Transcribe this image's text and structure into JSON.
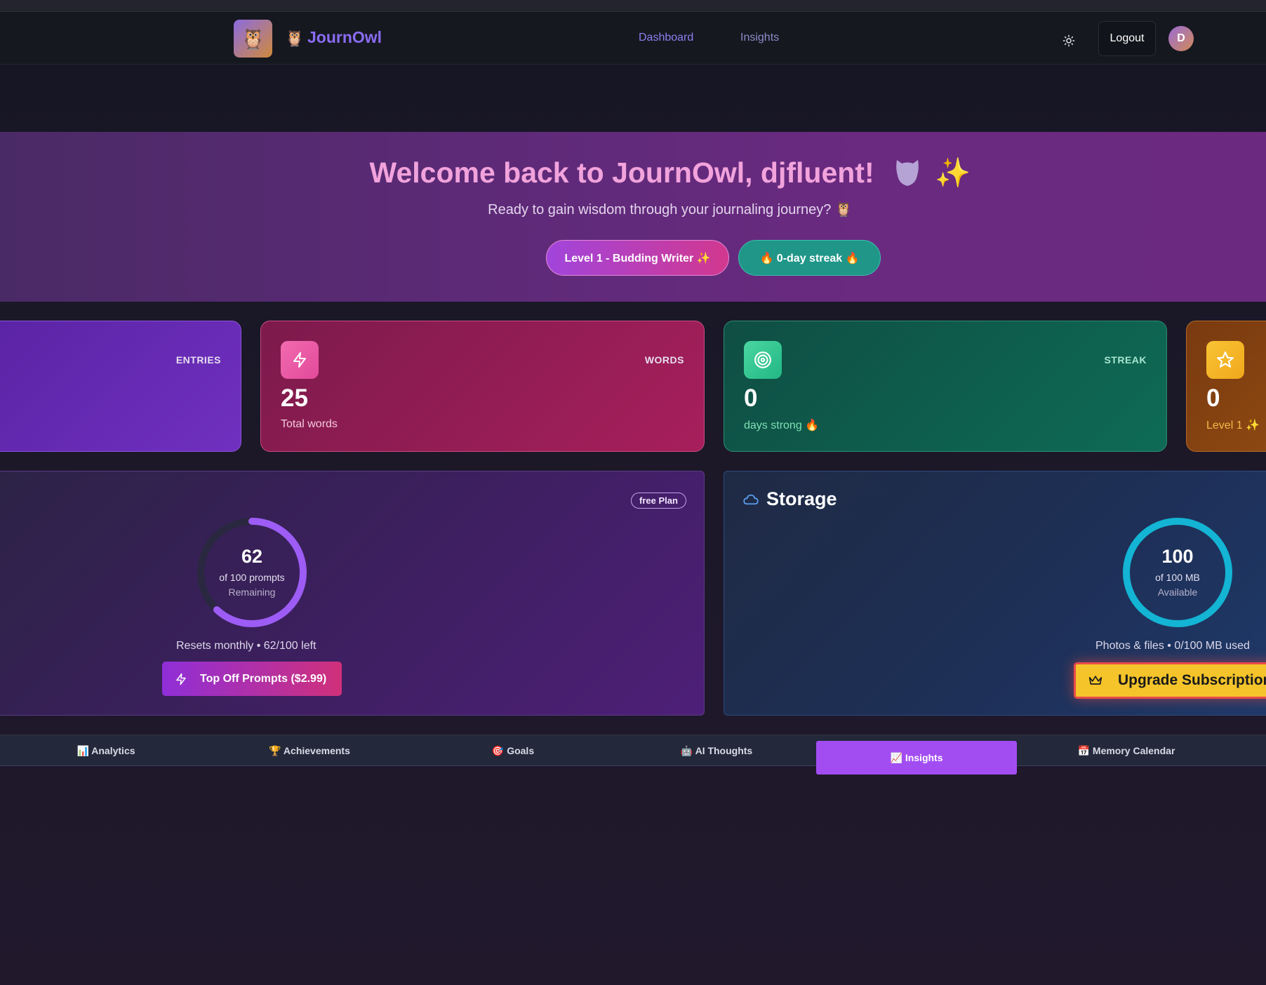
{
  "app": {
    "brand_emoji": "🦉",
    "brand_name": "JournOwl"
  },
  "nav": {
    "links": [
      "Dashboard",
      "Insights"
    ],
    "logout_label": "Logout",
    "avatar_initial": "D"
  },
  "hero": {
    "title": "Welcome back to JournOwl, djfluent!",
    "title_emoji": "✨",
    "subtitle": "Ready to gain wisdom through your journaling journey? 🦉",
    "level_pill": "Level 1 - Budding Writer ✨",
    "streak_pill": "🔥 0-day streak 🔥"
  },
  "stats": {
    "entries": {
      "label": "ENTRIES"
    },
    "words": {
      "label": "WORDS",
      "value": "25",
      "caption": "Total words"
    },
    "streak": {
      "label": "STREAK",
      "value": "0",
      "caption": "days strong 🔥"
    },
    "level": {
      "value": "0",
      "caption": "Level 1 ✨"
    }
  },
  "prompts": {
    "plan_badge": "free Plan",
    "remaining": "62",
    "total_label": "of 100 prompts",
    "status": "Remaining",
    "progress": 0.62,
    "reset_text": "Resets monthly • 62/100 left",
    "topoff_label": "Top Off Prompts ($2.99)"
  },
  "storage": {
    "title": "Storage",
    "available": "100",
    "total_label": "of 100 MB",
    "status": "Available",
    "progress": 1.0,
    "usage_text": "Photos & files • 0/100 MB used",
    "upgrade_label": "Upgrade Subscription"
  },
  "tabs": [
    {
      "label": "📊 Analytics"
    },
    {
      "label": "🏆 Achievements"
    },
    {
      "label": "🎯 Goals"
    },
    {
      "label": "🤖 AI Thoughts"
    },
    {
      "label": "📈 Insights",
      "active": true
    },
    {
      "label": "📅 Memory Calendar"
    }
  ],
  "colors": {
    "accent": "#a24df2",
    "prompt_ring": "#9d5cf5",
    "storage_ring": "#13b4d4",
    "upgrade": "#f4c42a"
  },
  "icons": {
    "theme": "sun-icon",
    "words": "lightning-icon",
    "streak": "target-icon",
    "level": "star-icon",
    "storage": "cloud-icon",
    "topoff": "lightning-icon",
    "upgrade": "crown-icon"
  }
}
